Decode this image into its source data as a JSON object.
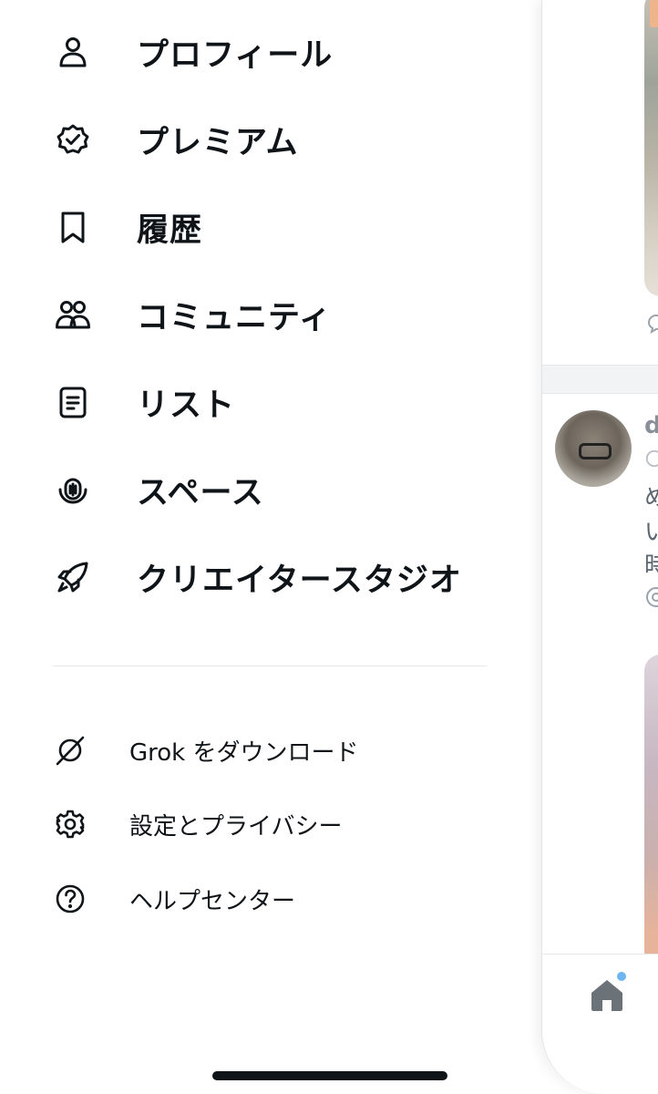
{
  "menu": {
    "items": [
      {
        "label": "プロフィール",
        "icon": "person-icon"
      },
      {
        "label": "プレミアム",
        "icon": "verified-badge-icon"
      },
      {
        "label": "履歴",
        "icon": "bookmark-icon"
      },
      {
        "label": "コミュニティ",
        "icon": "communities-icon"
      },
      {
        "label": "リスト",
        "icon": "list-icon"
      },
      {
        "label": "スペース",
        "icon": "spaces-icon"
      },
      {
        "label": "クリエイタースタジオ",
        "icon": "rocket-icon"
      }
    ]
  },
  "settings": {
    "items": [
      {
        "label": "Grok をダウンロード",
        "icon": "grok-icon"
      },
      {
        "label": "設定とプライバシー",
        "icon": "gear-icon"
      },
      {
        "label": "ヘルプセンター",
        "icon": "help-icon"
      }
    ]
  },
  "timeline": {
    "post_name": "d",
    "post_lines": [
      "め",
      "い",
      "時"
    ],
    "home_badge_color": "#6fb5ef"
  },
  "colors": {
    "text": "#0f1419",
    "divider": "#e6e9ec",
    "badge": "#6fb5ef"
  }
}
